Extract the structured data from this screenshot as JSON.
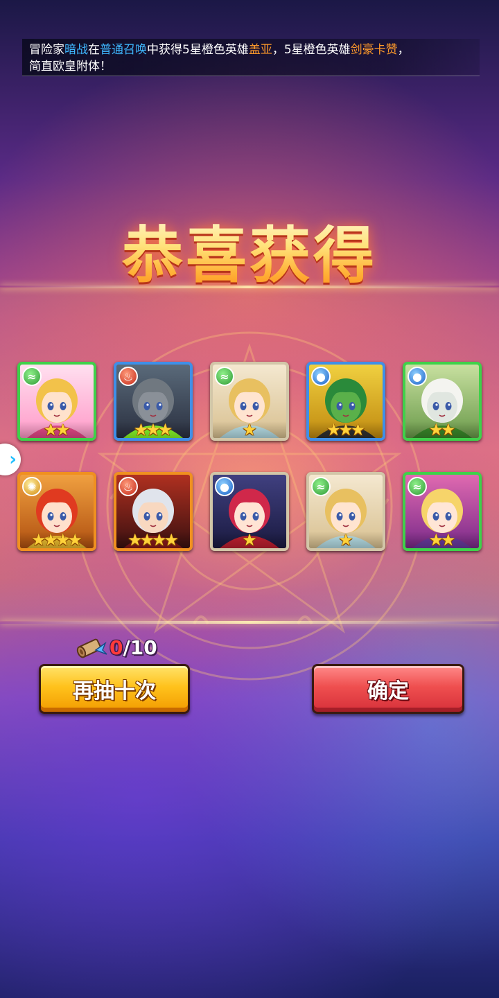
{
  "broadcast": {
    "seg1": "冒险家",
    "player": "暗战",
    "seg2": "在",
    "pool": "普通召唤",
    "seg3": "中获得5星橙色英雄",
    "hero1": "盖亚",
    "seg4": "，5星橙色英雄",
    "hero2": "剑豪卡赞",
    "seg5": "，",
    "seg6": "简直欧皇附体！"
  },
  "title": "恭喜获得",
  "colors": {
    "rarity_green": "#3fd14a",
    "rarity_blue": "#3f8fe8",
    "rarity_white": "#d2c6a8",
    "rarity_orange": "#f09020",
    "highlight_blue": "#3fb8ff",
    "highlight_orange": "#ff9a2a"
  },
  "heroes": [
    {
      "element": "wind",
      "element_icon": "wind-icon",
      "rarity": "green",
      "stars": 2,
      "portrait": "blonde-elf-girl"
    },
    {
      "element": "fire",
      "element_icon": "fire-icon",
      "rarity": "blue",
      "stars": 3,
      "portrait": "stone-golem"
    },
    {
      "element": "wind",
      "element_icon": "wind-icon",
      "rarity": "white",
      "stars": 1,
      "portrait": "blonde-fairy-shh"
    },
    {
      "element": "water",
      "element_icon": "water-icon",
      "rarity": "blue",
      "stars": 3,
      "portrait": "gas-mask-goblin"
    },
    {
      "element": "water",
      "element_icon": "water-icon",
      "rarity": "green",
      "stars": 2,
      "portrait": "white-wolf"
    },
    {
      "element": "light",
      "element_icon": "sun-icon",
      "rarity": "orange",
      "stars": 4,
      "portrait": "red-haired-knight"
    },
    {
      "element": "fire",
      "element_icon": "fire-icon",
      "rarity": "orange",
      "stars": 4,
      "portrait": "silver-haired-swordsman"
    },
    {
      "element": "water",
      "element_icon": "water-icon",
      "rarity": "white",
      "stars": 1,
      "portrait": "red-haired-girl"
    },
    {
      "element": "wind",
      "element_icon": "wind-icon",
      "rarity": "white",
      "stars": 1,
      "portrait": "blonde-fairy-shh"
    },
    {
      "element": "wind",
      "element_icon": "wind-icon",
      "rarity": "green",
      "stars": 2,
      "portrait": "blonde-cat-girl"
    }
  ],
  "ticket": {
    "icon": "scroll-icon",
    "current": "0",
    "separator_total": "/10"
  },
  "buttons": {
    "draw_again": "再抽十次",
    "confirm": "确定"
  },
  "side_arrow_icon": "chevron-right-icon"
}
